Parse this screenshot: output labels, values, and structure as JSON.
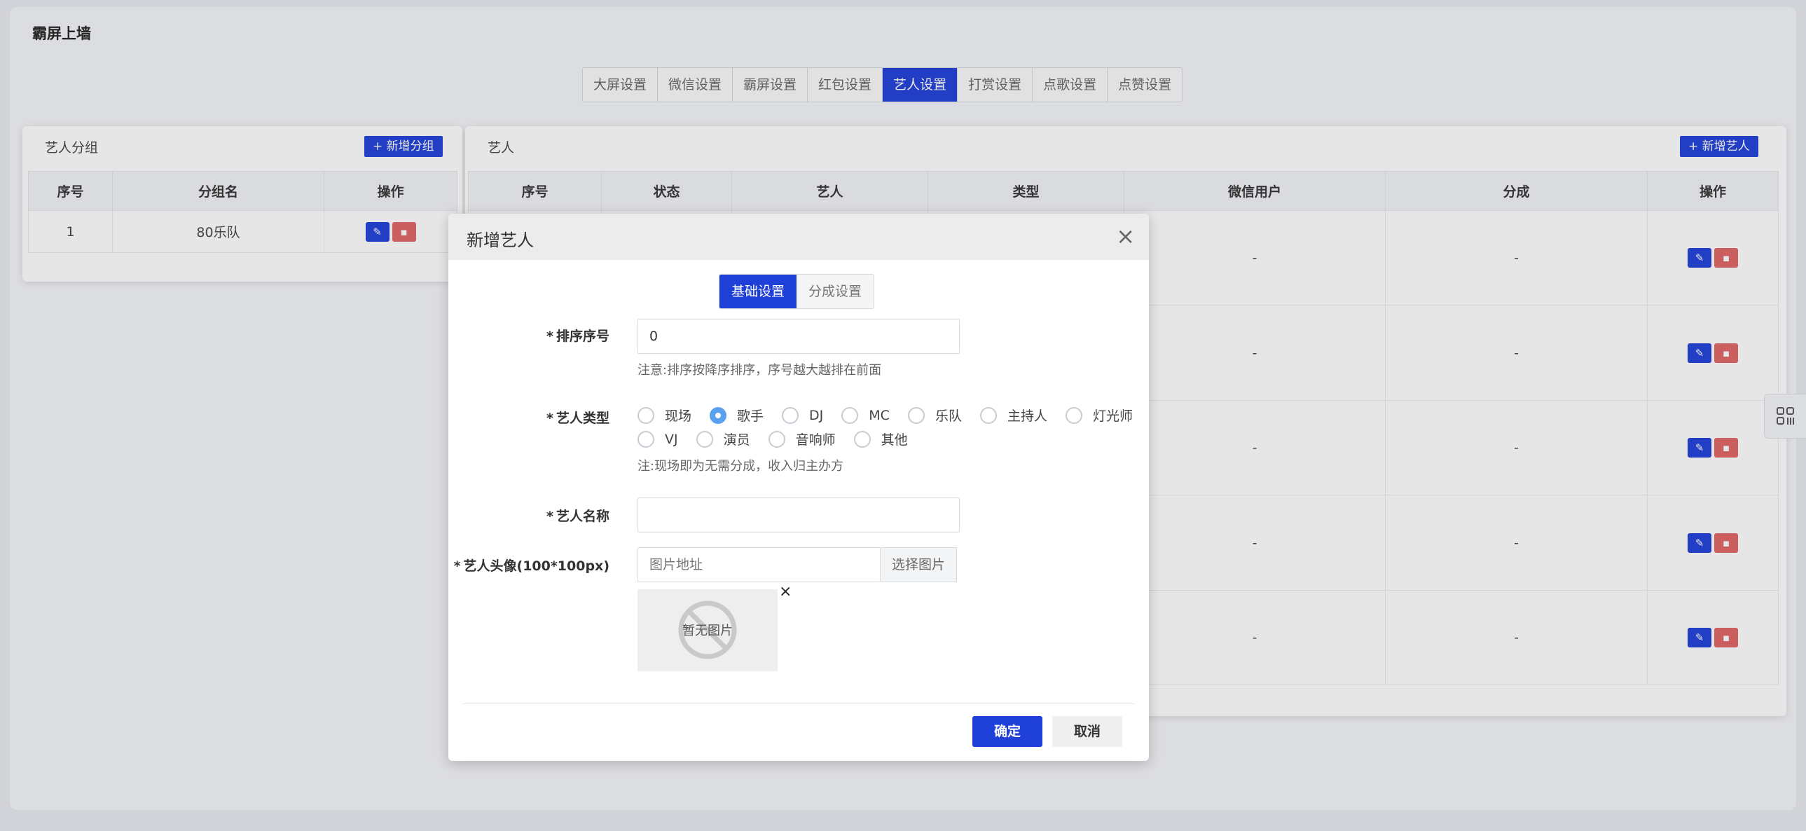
{
  "page": {
    "title": "霸屏上墙",
    "tabs": [
      "大屏设置",
      "微信设置",
      "霸屏设置",
      "红包设置",
      "艺人设置",
      "打赏设置",
      "点歌设置",
      "点赞设置"
    ],
    "active_tab": "艺人设置"
  },
  "group_panel": {
    "title": "艺人分组",
    "add_label": "+ 新增分组",
    "columns": [
      "序号",
      "分组名",
      "操作"
    ],
    "rows": [
      {
        "index": "1",
        "name": "80乐队"
      }
    ]
  },
  "artist_panel": {
    "title": "艺人",
    "add_label": "+ 新增艺人",
    "columns": [
      "序号",
      "状态",
      "艺人",
      "类型",
      "微信用户",
      "分成",
      "操作"
    ],
    "rows": [
      {
        "wechat": "-",
        "share": "-"
      },
      {
        "wechat": "-",
        "share": "-"
      },
      {
        "wechat": "-",
        "share": "-"
      },
      {
        "wechat": "-",
        "share": "-"
      },
      {
        "wechat": "-",
        "share": "-"
      }
    ]
  },
  "modal": {
    "title": "新增艺人",
    "close": "×",
    "tabs": [
      "基础设置",
      "分成设置"
    ],
    "active_tab": "基础设置",
    "sort": {
      "label": "排序序号",
      "value": "0",
      "hint": "注意:排序按降序排序，序号越大越排在前面"
    },
    "type": {
      "label": "艺人类型",
      "options_row1": [
        "现场",
        "歌手",
        "DJ",
        "MC",
        "乐队",
        "主持人",
        "灯光师"
      ],
      "options_row2": [
        "VJ",
        "演员",
        "音响师",
        "其他"
      ],
      "selected": "歌手",
      "hint": "注:现场即为无需分成，收入归主办方"
    },
    "name": {
      "label": "艺人名称",
      "value": ""
    },
    "avatar": {
      "label": "艺人头像(100*100px)",
      "placeholder": "图片地址",
      "pick_label": "选择图片",
      "no_image": "暂无图片",
      "remove": "×"
    },
    "ok_label": "确定",
    "cancel_label": "取消"
  },
  "colors": {
    "primary": "#1e3fd8",
    "danger": "#e06565",
    "radio_selected": "#5aa0f0"
  }
}
